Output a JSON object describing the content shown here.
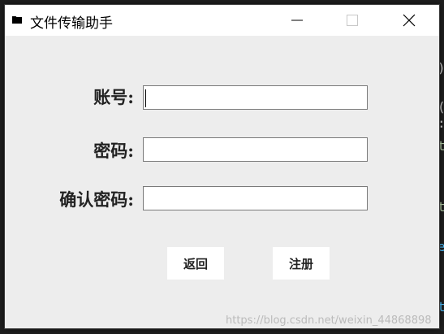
{
  "window": {
    "title": "文件传输助手",
    "icon": "folder-icon"
  },
  "form": {
    "account_label": "账号:",
    "account_value": "",
    "password_label": "密码:",
    "password_value": "",
    "confirm_label": "确认密码:",
    "confirm_value": ""
  },
  "buttons": {
    "back_label": "返回",
    "register_label": "注册"
  },
  "watermark": "https://blog.csdn.net/weixin_44868898",
  "background_code": {
    "glyphs": [
      ")",
      "(",
      ":",
      "t",
      "t",
      "e",
      "t"
    ],
    "colors": [
      "#d4d4d4",
      "#d4d4d4",
      "#d4d4d4",
      "#b5cea8",
      "#b5cea8",
      "#4fc1ff",
      "#4fc1ff"
    ]
  },
  "colors": {
    "window_bg": "#ededed",
    "titlebar_bg": "#ffffff",
    "editor_bg": "#1e1e1e"
  }
}
